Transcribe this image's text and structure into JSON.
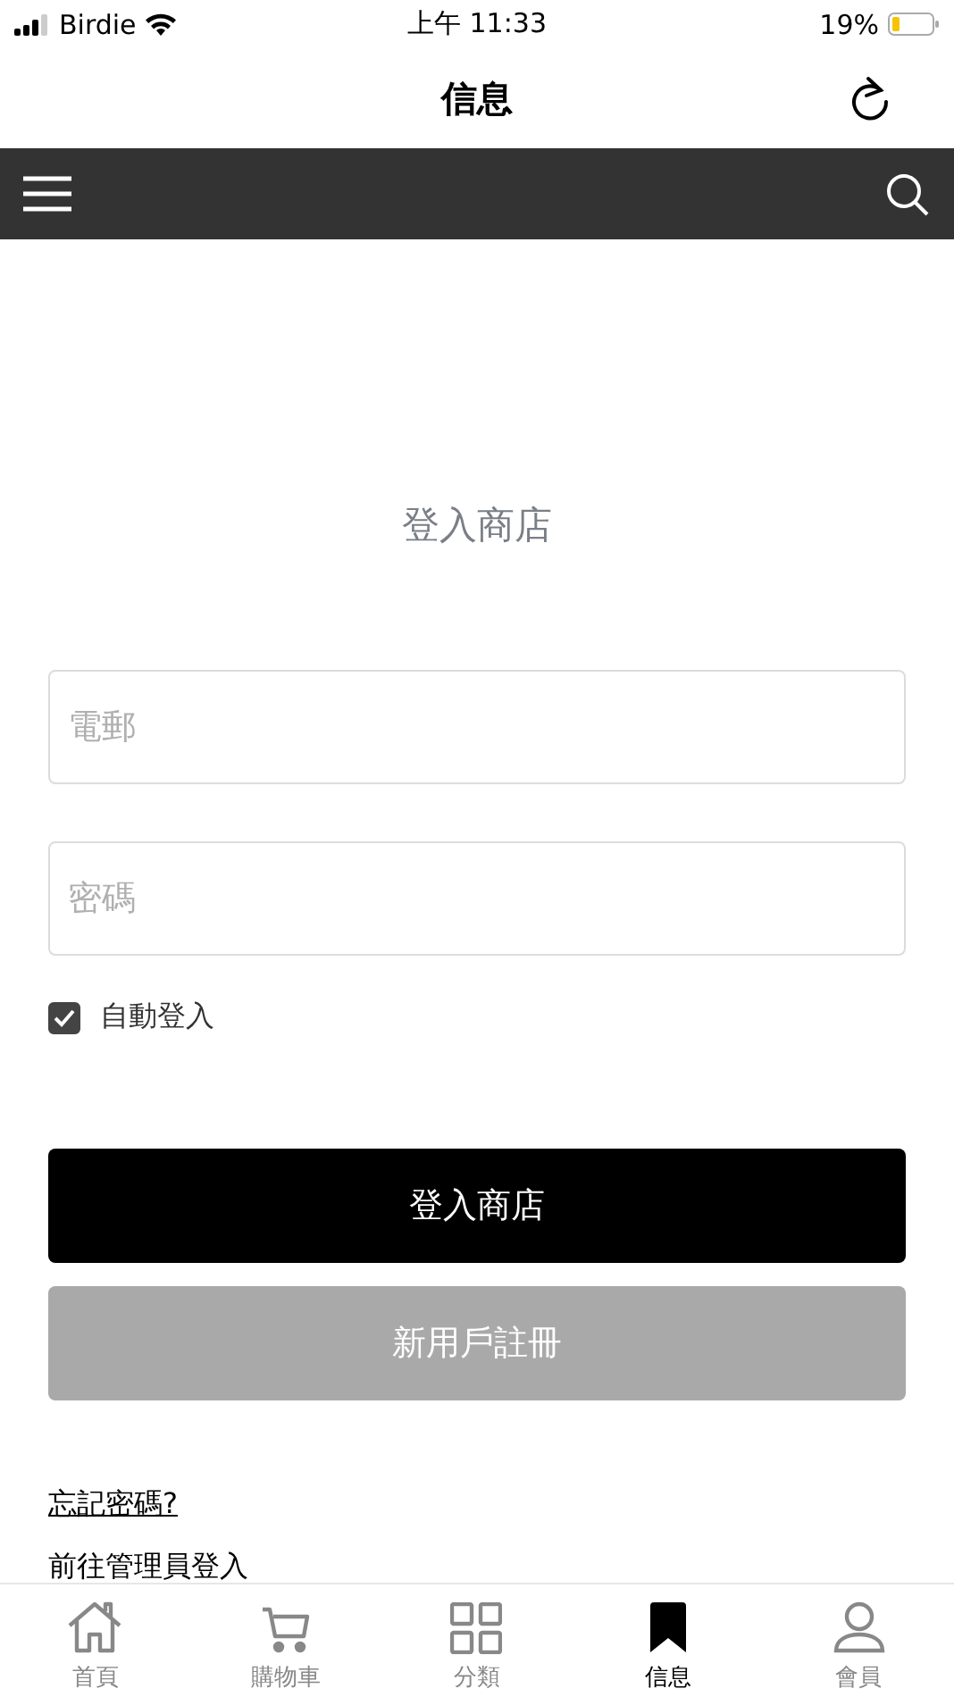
{
  "status_bar": {
    "carrier": "Birdie",
    "time": "上午 11:33",
    "battery": "19%"
  },
  "title_bar": {
    "title": "信息"
  },
  "heading": "登入商店",
  "fields": [
    {
      "placeholder": "電郵"
    },
    {
      "placeholder": "密碼"
    }
  ],
  "auto_login": {
    "label": "自動登入",
    "checked": true
  },
  "buttons": [
    {
      "label": "登入商店",
      "kind": "primary"
    },
    {
      "label": "新用戶註冊",
      "kind": "secondary"
    }
  ],
  "links": [
    {
      "label": "忘記密碼?",
      "underlined": true
    },
    {
      "label": "前往管理員登入",
      "underlined": false
    }
  ],
  "tab_bar": [
    {
      "label": "首頁",
      "selected": false
    },
    {
      "label": "購物車",
      "selected": false
    },
    {
      "label": "分類",
      "selected": false
    },
    {
      "label": "信息",
      "selected": true
    },
    {
      "label": "會員",
      "selected": false
    }
  ]
}
